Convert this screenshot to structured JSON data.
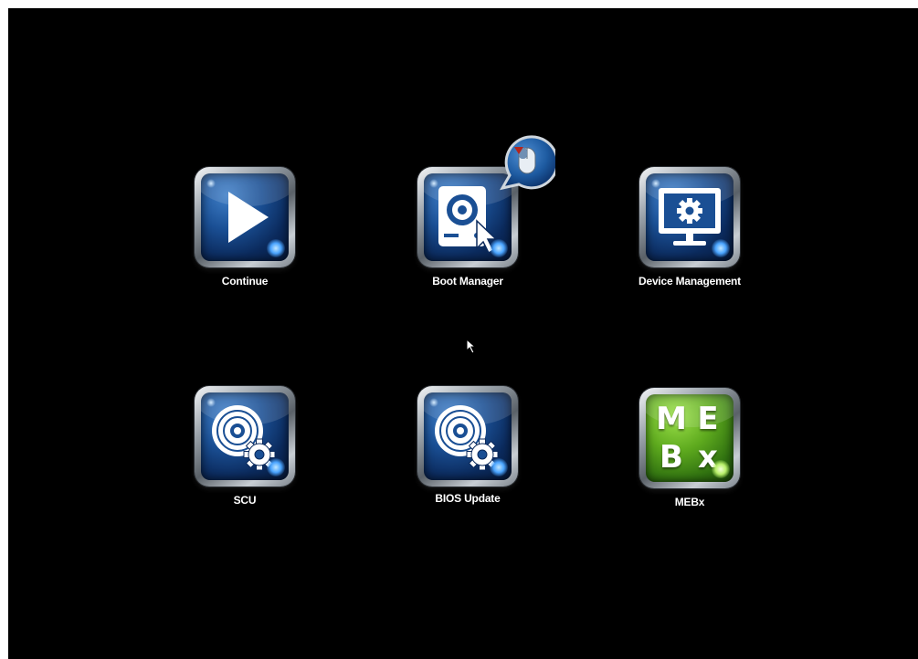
{
  "menu": {
    "items": [
      {
        "id": "continue",
        "label": "Continue",
        "icon": "play-icon"
      },
      {
        "id": "boot-manager",
        "label": "Boot Manager",
        "icon": "boot-disk-icon"
      },
      {
        "id": "device-management",
        "label": "Device Management",
        "icon": "monitor-gear-icon"
      },
      {
        "id": "scu",
        "label": "SCU",
        "icon": "disc-gear-icon"
      },
      {
        "id": "bios-update",
        "label": "BIOS Update",
        "icon": "disc-gear-icon"
      },
      {
        "id": "mebx",
        "label": "MEBx",
        "icon": "mebx-logo-icon",
        "logo_text": [
          "M",
          "E",
          "B",
          "x"
        ]
      }
    ],
    "selected": "Boot Manager"
  },
  "hint": {
    "icon": "mouse-click-hint-icon"
  },
  "cursor": {
    "icon": "mouse-pointer-icon"
  },
  "colors": {
    "background": "#000000",
    "tile_blue": "#1a4f94",
    "tile_green": "#5eaa1e",
    "label": "#ffffff"
  }
}
